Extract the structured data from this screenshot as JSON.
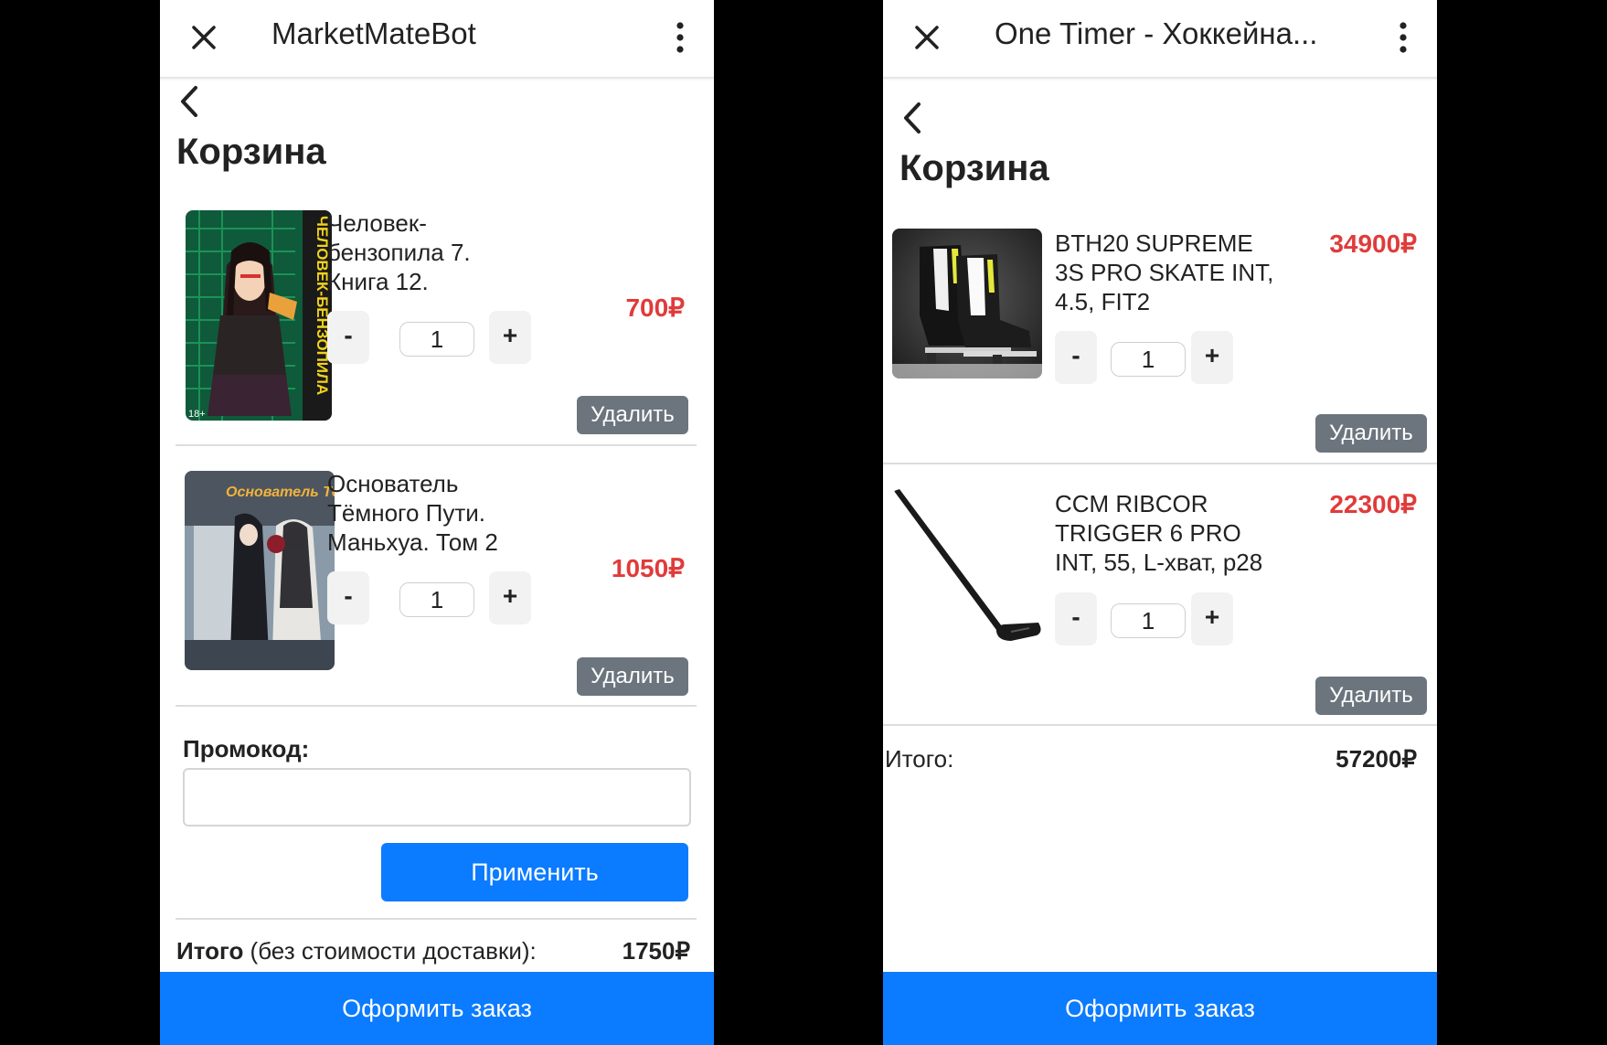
{
  "screen1": {
    "title": "MarketMateBot",
    "heading": "Корзина",
    "items": [
      {
        "name": "Человек-бензопила 7. Книга 12.",
        "price": "700₽",
        "qty": "1",
        "minus": "-",
        "plus": "+",
        "delete": "Удалить"
      },
      {
        "name": "Основатель Тёмного Пути. Маньхуа. Том 2",
        "price": "1050₽",
        "qty": "1",
        "minus": "-",
        "plus": "+",
        "delete": "Удалить"
      }
    ],
    "promo_label": "Промокод:",
    "promo_value": "",
    "apply_label": "Применить",
    "total_label_bold": "Итого",
    "total_label_rest": " (без стоимости доставки):",
    "total_value": "1750₽",
    "order_label": "Оформить заказ",
    "cover1_text": "ЧЕЛОВЕК-БЕНЗОПИЛА",
    "cover1_age": "18+",
    "cover2_text": "Основатель Тёмного Пути"
  },
  "screen2": {
    "title": "One Timer - Хоккейна...",
    "heading": "Корзина",
    "items": [
      {
        "name": "BTH20 SUPREME 3S PRO SKATE INT, 4.5, FIT2",
        "price": "34900₽",
        "qty": "1",
        "minus": "-",
        "plus": "+",
        "delete": "Удалить"
      },
      {
        "name": "CCM RIBCOR TRIGGER 6 PRO INT, 55, L-хват, р28",
        "price": "22300₽",
        "qty": "1",
        "minus": "-",
        "plus": "+",
        "delete": "Удалить"
      }
    ],
    "total_label": "Итого:",
    "total_value": "57200₽",
    "order_label": "Оформить заказ"
  },
  "colors": {
    "accent": "#0b7bff",
    "price": "#e03b3b",
    "delete_button": "#6c757d"
  },
  "icons": [
    "close-icon",
    "more-vert-icon",
    "back-chevron-icon"
  ]
}
